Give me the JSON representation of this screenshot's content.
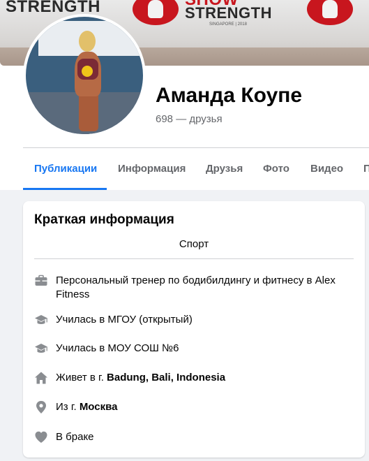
{
  "profile": {
    "name": "Аманда Коупе",
    "friends": "698 — друзья"
  },
  "cover": {
    "text_left": "STRENGTH",
    "text_right_top": "SHOW",
    "text_right": "STRENGTH",
    "event_line": "SINGAPORE | 2018"
  },
  "tabs": [
    {
      "label": "Публикации"
    },
    {
      "label": "Информация"
    },
    {
      "label": "Друзья"
    },
    {
      "label": "Фото"
    },
    {
      "label": "Видео"
    },
    {
      "label": "П"
    }
  ],
  "intro": {
    "title": "Краткая информация",
    "subtitle": "Спорт",
    "items": [
      {
        "icon": "briefcase-icon",
        "prefix": "Персональный тренер по бодибилдингу и фитнесу в Alex Fitness",
        "bold": ""
      },
      {
        "icon": "graduation-cap-icon",
        "prefix": "Училась в МГОУ (открытый)",
        "bold": ""
      },
      {
        "icon": "graduation-cap-icon",
        "prefix": "Училась в МОУ СОШ №6",
        "bold": ""
      },
      {
        "icon": "home-icon",
        "prefix": "Живет в г. ",
        "bold": "Badung, Bali, Indonesia"
      },
      {
        "icon": "location-pin-icon",
        "prefix": "Из г. ",
        "bold": "Москва"
      },
      {
        "icon": "heart-icon",
        "prefix": "В браке",
        "bold": ""
      }
    ]
  },
  "colors": {
    "accent": "#1877f2",
    "secondary_text": "#65676b",
    "icon": "#8a8d91"
  }
}
